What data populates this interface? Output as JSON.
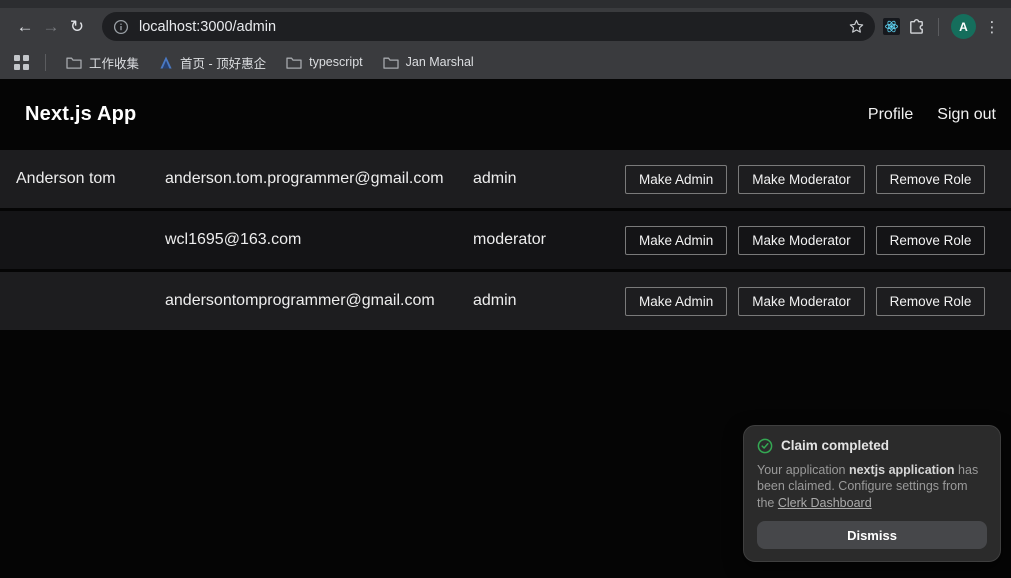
{
  "browser": {
    "url": "localhost:3000/admin",
    "avatar_letter": "A",
    "icons": [
      "back-icon",
      "forward-icon",
      "reload-icon",
      "info-icon",
      "bookmark-star-icon",
      "react-devtools-icon",
      "extensions-icon",
      "profile-avatar",
      "menu-kebab-icon",
      "apps-grid-icon"
    ],
    "bookmarks": [
      {
        "label": "工作收集",
        "icon": "folder-icon"
      },
      {
        "label": "首页 - 顶好惠企",
        "icon": "site-favicon"
      },
      {
        "label": "typescript",
        "icon": "folder-icon"
      },
      {
        "label": "Jan Marshal",
        "icon": "folder-icon"
      }
    ]
  },
  "header": {
    "title": "Next.js App",
    "nav": [
      {
        "label": "Profile"
      },
      {
        "label": "Sign out"
      }
    ]
  },
  "users": {
    "rows": [
      {
        "name": "Anderson tom",
        "email": "anderson.tom.programmer@gmail.com",
        "role": "admin"
      },
      {
        "name": "",
        "email": "wcl1695@163.com",
        "role": "moderator"
      },
      {
        "name": "",
        "email": "andersontomprogrammer@gmail.com",
        "role": "admin"
      }
    ],
    "actions": [
      "Make Admin",
      "Make Moderator",
      "Remove Role"
    ]
  },
  "toast": {
    "title": "Claim completed",
    "body_prefix": "Your application ",
    "body_bold": "nextjs application",
    "body_middle": " has been claimed. Configure settings from the ",
    "body_link": "Clerk Dashboard",
    "dismiss_label": "Dismiss"
  },
  "colors": {
    "toast_success_green": "#34a853",
    "avatar_green": "#156e5c",
    "react_blue": "#61dafb",
    "chrome_toolbar": "#3a3b3e",
    "omnibox": "#1e1f22",
    "page_background": "#050505"
  }
}
